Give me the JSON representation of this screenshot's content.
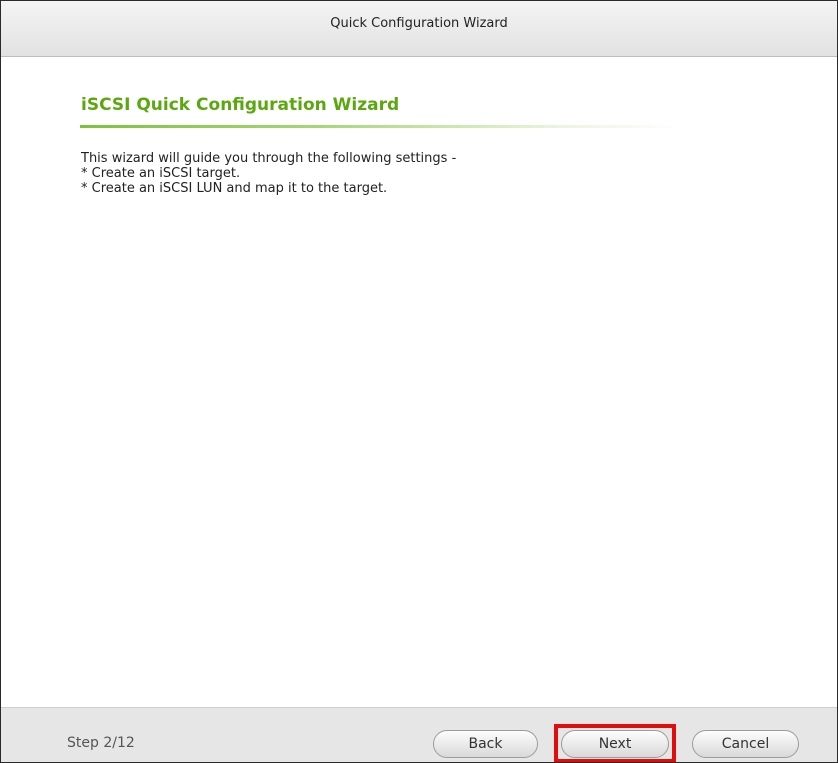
{
  "window": {
    "title": "Quick Configuration Wizard"
  },
  "content": {
    "heading": "iSCSI Quick Configuration Wizard",
    "lines": [
      "This wizard will guide you through the following settings -",
      "* Create an iSCSI target.",
      "* Create an iSCSI LUN and map it to the target."
    ]
  },
  "footer": {
    "step": "Step 2/12",
    "back_label": "Back",
    "next_label": "Next",
    "cancel_label": "Cancel"
  },
  "colors": {
    "heading": "#5aa80e",
    "highlight": "#e10d0d"
  }
}
